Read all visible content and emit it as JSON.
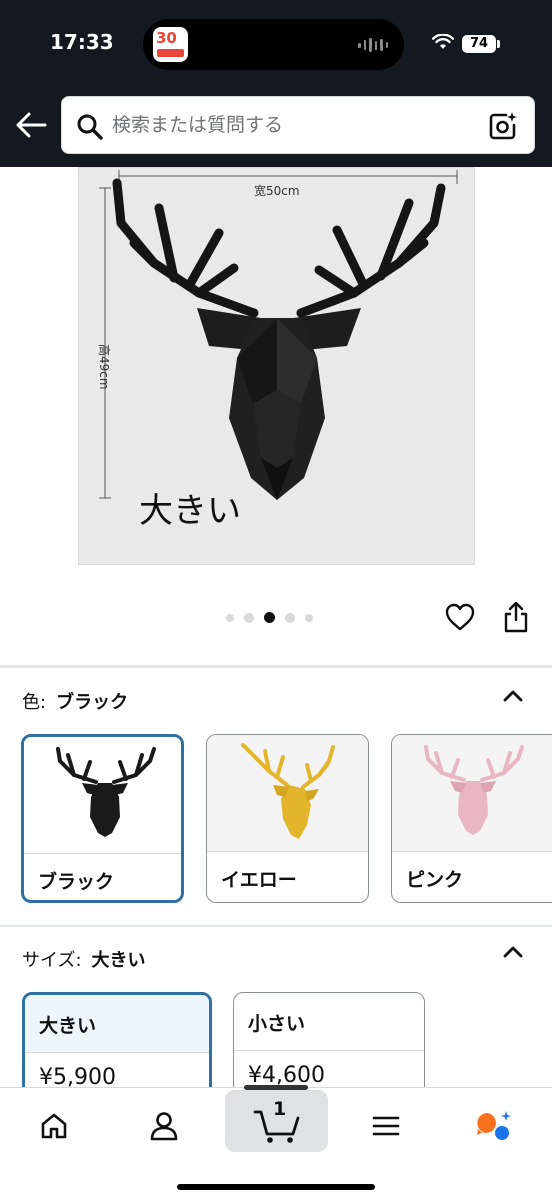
{
  "status_bar": {
    "time": "17:33",
    "battery": "74",
    "island_app_badge": "30"
  },
  "header": {
    "search_placeholder": "検索または質問する",
    "icons": [
      "back-arrow-icon",
      "search-icon",
      "camera-icon"
    ]
  },
  "product_image": {
    "width_label": "宽50cm",
    "height_label": "高49cm",
    "size_text": "大きい",
    "carousel_total": 5,
    "carousel_active": 3
  },
  "color_option": {
    "label": "色:",
    "selected": "ブラック",
    "swatches": [
      {
        "label": "ブラック",
        "color": "#1a1a1a"
      },
      {
        "label": "イエロー",
        "color": "#e3b52c"
      },
      {
        "label": "ピンク",
        "color": "#e9b6c3"
      }
    ]
  },
  "size_option": {
    "label": "サイズ:",
    "selected": "大きい",
    "cards": [
      {
        "name": "大きい",
        "price": "¥5,900"
      },
      {
        "name": "小さい",
        "price": "¥4,600"
      }
    ]
  },
  "tab_bar": {
    "cart_count": "1",
    "tabs": [
      "home-icon",
      "account-icon",
      "cart-icon",
      "menu-icon",
      "rufus-icon"
    ]
  },
  "colors": {
    "header_bg": "#131921",
    "selected_border": "#2f6fa3",
    "selected_size_bg": "#edf6fd",
    "rufus_orange": "#f7711f",
    "rufus_blue": "#1a73e8"
  }
}
